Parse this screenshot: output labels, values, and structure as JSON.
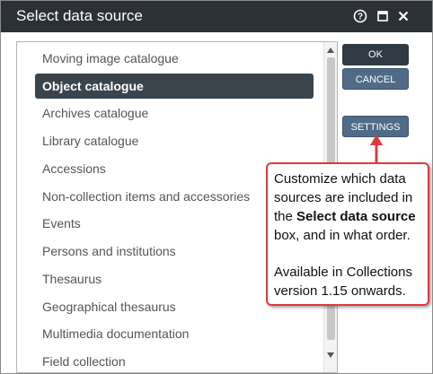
{
  "dialog": {
    "title": "Select data source",
    "icons": {
      "help": "help-icon",
      "maximize": "maximize-icon",
      "close": "close-icon"
    }
  },
  "list": {
    "items": [
      {
        "label": "Moving image catalogue",
        "selected": false
      },
      {
        "label": "Object catalogue",
        "selected": true
      },
      {
        "label": "Archives catalogue",
        "selected": false
      },
      {
        "label": "Library catalogue",
        "selected": false
      },
      {
        "label": "Accessions",
        "selected": false
      },
      {
        "label": "Non-collection items and accessories",
        "selected": false
      },
      {
        "label": "Events",
        "selected": false
      },
      {
        "label": "Persons and institutions",
        "selected": false
      },
      {
        "label": "Thesaurus",
        "selected": false
      },
      {
        "label": "Geographical thesaurus",
        "selected": false
      },
      {
        "label": "Multimedia documentation",
        "selected": false
      },
      {
        "label": "Field collection",
        "selected": false
      }
    ]
  },
  "buttons": {
    "ok": "OK",
    "cancel": "CANCEL",
    "settings": "SETTINGS"
  },
  "callout": {
    "line1_pre": "Customize which data sources are included in the",
    "line1_bold": "Select data source",
    "line1_post": "box, and in what order.",
    "line2": "Available in Collections version 1.15 onwards."
  },
  "colors": {
    "titlebar": "#2b3137",
    "selected_item": "#3a444c",
    "ok_button": "#2f3a44",
    "secondary_button": "#4f6b86",
    "callout_border": "#e0383e"
  }
}
